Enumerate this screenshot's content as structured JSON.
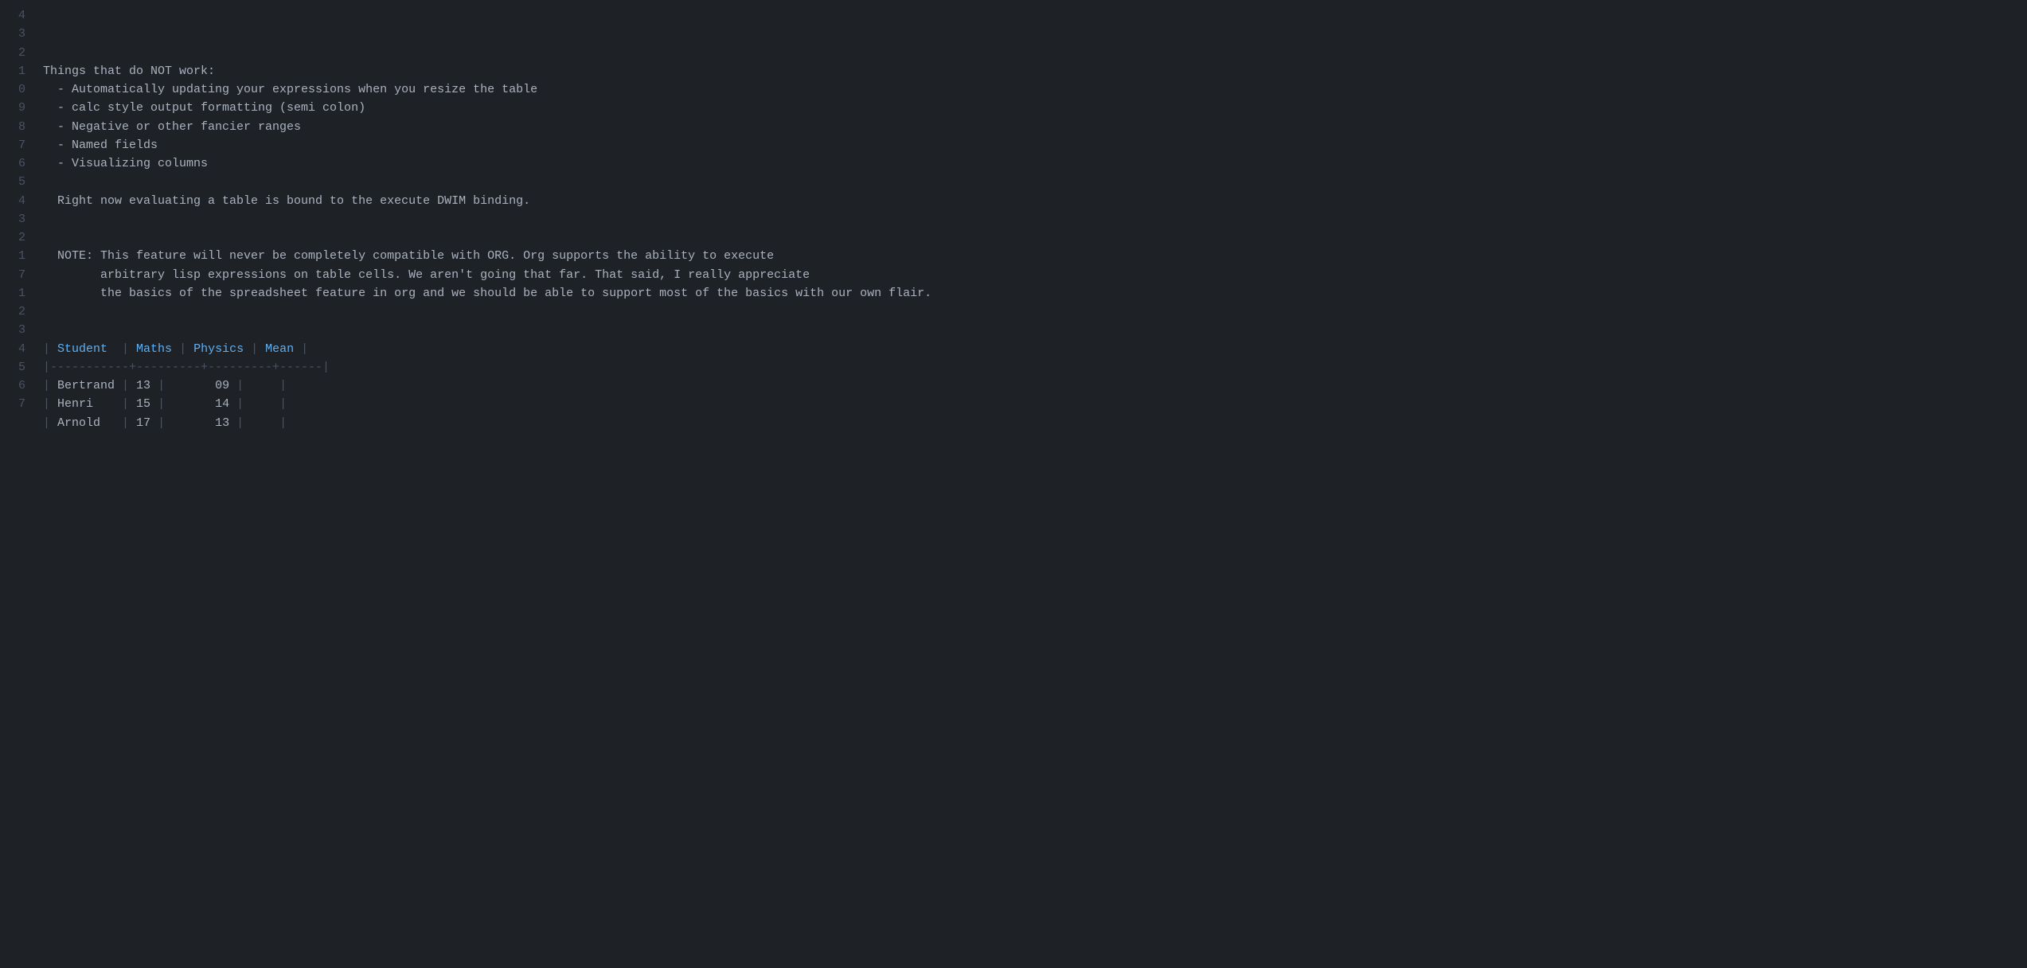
{
  "editor": {
    "background": "#1e2227",
    "text_color": "#abb2bf",
    "line_number_color": "#4b5263",
    "keyword_color": "#e5c07b",
    "highlight_color": "#61afef"
  },
  "lines": [
    {
      "num": "4",
      "content": "Things that do NOT work:"
    },
    {
      "num": "3",
      "content": "  - Automatically updating your expressions when you resize the table"
    },
    {
      "num": "2",
      "content": "  - calc style output formatting (semi colon)"
    },
    {
      "num": "1",
      "content": "  - Negative or other fancier ranges"
    },
    {
      "num": "0",
      "content": "  - Named fields"
    },
    {
      "num": "9",
      "content": "  - Visualizing columns"
    },
    {
      "num": "8",
      "content": ""
    },
    {
      "num": "7",
      "content": "  Right now evaluating a table is bound to the execute DWIM binding."
    },
    {
      "num": "6",
      "content": ""
    },
    {
      "num": "5",
      "content": ""
    },
    {
      "num": "4",
      "content": "  NOTE: This feature will never be completely compatible with ORG. Org supports the ability to execute"
    },
    {
      "num": "3",
      "content": "        arbitrary lisp expressions on table cells. We aren't going that far. That said, I really appreciate"
    },
    {
      "num": "2",
      "content": "        the basics of the spreadsheet feature in org and we should be able to support most of the basics with our own flair."
    },
    {
      "num": "1",
      "content": ""
    },
    {
      "num": "7",
      "content": ""
    }
  ],
  "table": {
    "header": [
      "Student",
      "Maths",
      "Physics",
      "Mean"
    ],
    "rows": [
      [
        "Bertrand",
        "13",
        "09",
        ""
      ],
      [
        "Henri",
        "15",
        "14",
        ""
      ],
      [
        "Arnold",
        "17",
        "13",
        ""
      ]
    ],
    "after_lines": [
      "",
      ""
    ]
  }
}
